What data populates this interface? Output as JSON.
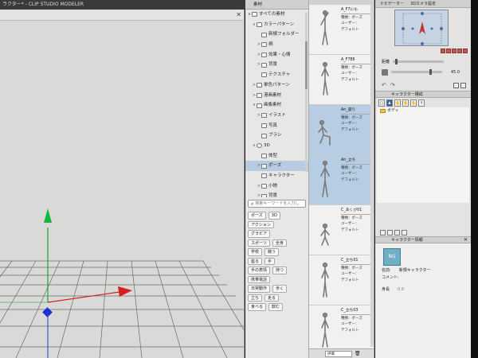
{
  "titlebar": {
    "title": "ラクター* - CLIP STUDIO MODELER"
  },
  "viewport": {
    "close_label": "✕"
  },
  "tree": {
    "header": "素材",
    "items": [
      {
        "label": "すべての素材",
        "toggle": "∨",
        "depth": 0,
        "selected": false
      },
      {
        "label": "カラーパターン",
        "toggle": "∨",
        "depth": 1,
        "selected": false
      },
      {
        "label": "新規フォルダー",
        "toggle": "",
        "depth": 2,
        "selected": false
      },
      {
        "label": "柄",
        "toggle": ">",
        "depth": 2,
        "selected": false
      },
      {
        "label": "効果・心情",
        "toggle": ">",
        "depth": 2,
        "selected": false
      },
      {
        "label": "背景",
        "toggle": ">",
        "depth": 2,
        "selected": false
      },
      {
        "label": "テクスチャ",
        "toggle": "",
        "depth": 2,
        "selected": false
      },
      {
        "label": "単色パターン",
        "toggle": ">",
        "depth": 1,
        "selected": false
      },
      {
        "label": "漫画素材",
        "toggle": ">",
        "depth": 1,
        "selected": false
      },
      {
        "label": "画像素材",
        "toggle": "∨",
        "depth": 1,
        "selected": false
      },
      {
        "label": "イラスト",
        "toggle": ">",
        "depth": 2,
        "selected": false
      },
      {
        "label": "写真",
        "toggle": "",
        "depth": 2,
        "selected": false
      },
      {
        "label": "ブラシ",
        "toggle": "",
        "depth": 2,
        "selected": false
      },
      {
        "label": "3D",
        "toggle": "∨",
        "depth": 1,
        "selected": false
      },
      {
        "label": "体型",
        "toggle": "",
        "depth": 2,
        "selected": false
      },
      {
        "label": "ポーズ",
        "toggle": ">",
        "depth": 2,
        "selected": true
      },
      {
        "label": "キャラクター",
        "toggle": "",
        "depth": 2,
        "selected": false
      },
      {
        "label": "小物",
        "toggle": ">",
        "depth": 2,
        "selected": false
      },
      {
        "label": "背景",
        "toggle": ">",
        "depth": 2,
        "selected": false
      }
    ],
    "search_placeholder": "検索キーワードを入力し",
    "tags": [
      [
        "ポーズ",
        "3D"
      ],
      [
        "アクション"
      ],
      [
        "グラビア"
      ],
      [
        "スポーツ",
        "全身"
      ],
      [
        "学校",
        "戦う"
      ],
      [
        "座る",
        "手"
      ],
      [
        "手の表情",
        "持つ"
      ],
      [
        "携帯電話"
      ],
      [
        "日常動作",
        "歩く"
      ],
      [
        "立ち",
        "走る"
      ],
      [
        "食べる",
        "飲む"
      ]
    ]
  },
  "materials": {
    "items": [
      {
        "name": "A_F7にも",
        "type": "種類：ポーズ",
        "author": "ユーザー：",
        "note": "デフォルト",
        "selected": false,
        "pose": "stand-a"
      },
      {
        "name": "A_F7E6",
        "type": "種類：ポーズ",
        "author": "ユーザー：",
        "note": "デフォルト",
        "selected": false,
        "pose": "stand-b"
      },
      {
        "name": "An_座り",
        "type": "種類：ポーズ",
        "author": "ユーザー：",
        "note": "デフォルト",
        "selected": true,
        "pose": "sit"
      },
      {
        "name": "An_立ち",
        "type": "種類：ポーズ",
        "author": "ユーザー：",
        "note": "デフォルト",
        "selected": true,
        "pose": "stand-c"
      },
      {
        "name": "C_あくび01",
        "type": "種類：ポーズ",
        "author": "ユーザー：",
        "note": "デフォルト",
        "selected": false,
        "pose": "crouch"
      },
      {
        "name": "C_立ち01",
        "type": "種類：ポーズ",
        "author": "ユーザー：",
        "note": "デフォルト",
        "selected": false,
        "pose": "stand-d"
      },
      {
        "name": "C_立ち03",
        "type": "種類：ポーズ",
        "author": "ユーザー：",
        "note": "デフォルト",
        "selected": false,
        "pose": "stand-e"
      }
    ],
    "sort_label": "評価"
  },
  "navigator": {
    "tabs": [
      "ナビゲーター",
      "3Dカメラ設定"
    ],
    "zoom_label": "距離",
    "zoom_value": "",
    "zoom_level": 0.05,
    "angle_value": "45.0",
    "angle_level": 0.78
  },
  "layer": {
    "header": "キャラクター構成",
    "rows": [
      {
        "label": "ボディ"
      }
    ]
  },
  "character": {
    "header": "キャラクター情報",
    "icon_text": "NG",
    "name_key": "名前:",
    "name_value": "新規キャラクター",
    "comment_key": "コメント:",
    "height_key": "身長",
    "height_value": "0.0"
  }
}
